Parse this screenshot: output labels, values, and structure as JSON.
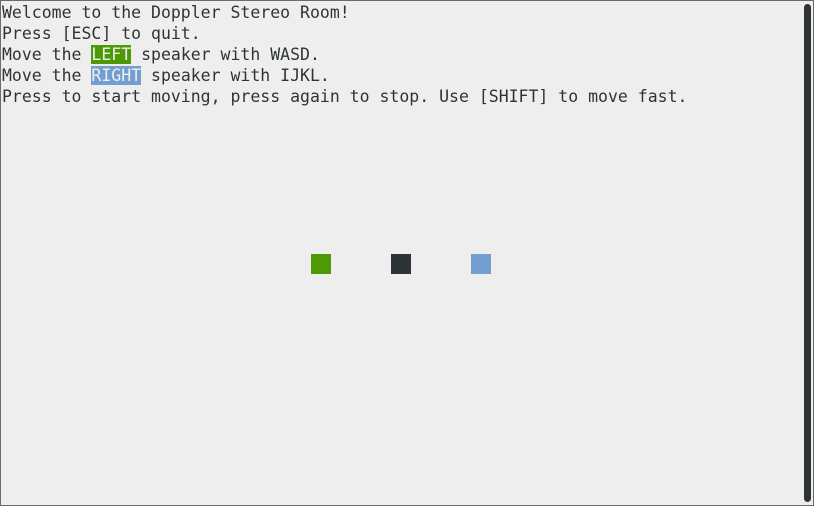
{
  "lines": {
    "welcome": "Welcome to the Doppler Stereo Room!",
    "quit": "Press [ESC] to quit.",
    "left_prefix": "Move the ",
    "left_word": "LEFT",
    "left_suffix": " speaker with WASD.",
    "right_prefix": "Move the ",
    "right_word": "RIGHT",
    "right_suffix": " speaker with IJKL.",
    "instructions": "Press to start moving, press again to stop. Use [SHIFT] to move fast."
  },
  "colors": {
    "left_speaker": "#4e9a06",
    "listener": "#2e3436",
    "right_speaker": "#729fcf",
    "background": "#eeeeee",
    "text": "#2e3436"
  },
  "icons": {
    "left_speaker": "square-block",
    "listener": "square-block",
    "right_speaker": "square-block"
  }
}
